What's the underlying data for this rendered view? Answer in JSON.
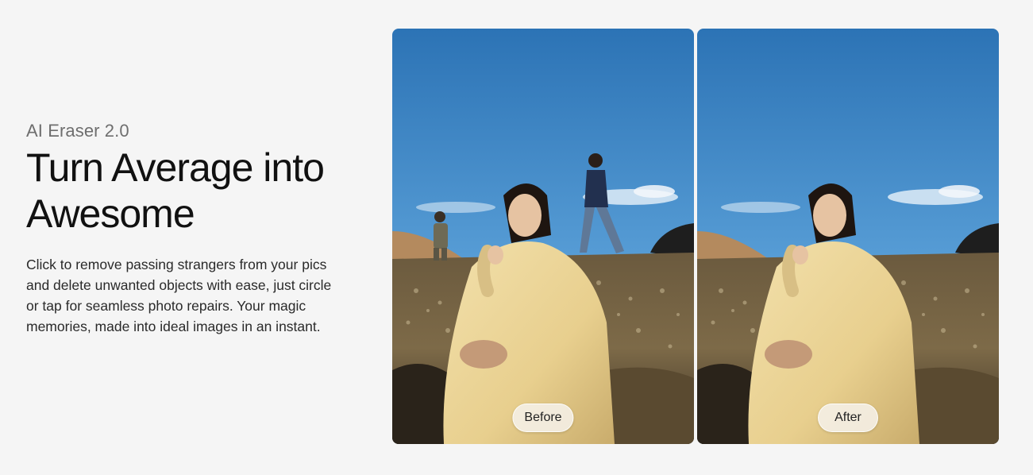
{
  "hero": {
    "eyebrow": "AI Eraser 2.0",
    "headline": "Turn Average into Awesome",
    "description": "Click to remove passing strangers from your pics and delete unwanted objects with ease, just circle or tap for seamless photo repairs. Your magic memories, made into ideal images in an instant."
  },
  "comparison": {
    "before_label": "Before",
    "after_label": "After"
  },
  "colors": {
    "page_background": "#f5f5f5",
    "headline": "#111111",
    "eyebrow": "#6e6e6e",
    "sky_top": "#2f78b8",
    "sky_bottom": "#8fc3e8",
    "outfit": "#ecd699"
  }
}
